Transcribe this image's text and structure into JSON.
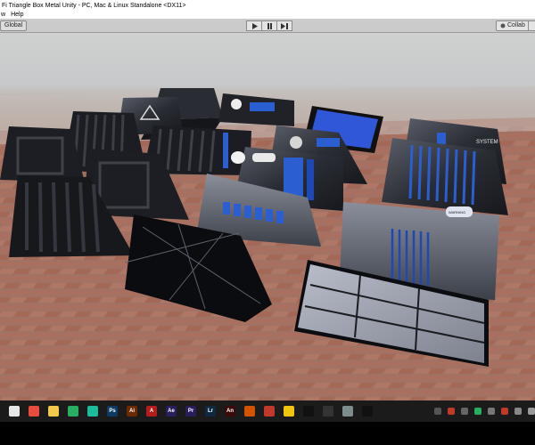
{
  "window": {
    "title": "Fi Triangle Box Metal Unity - PC, Mac & Linux Standalone <DX11>"
  },
  "menu": {
    "items": [
      {
        "label": "w"
      },
      {
        "label": "Help"
      }
    ]
  },
  "toolbar": {
    "global_label": "Global",
    "collab_label": "Collab"
  },
  "scene": {
    "panel_labels": [
      "SYSTEM",
      "WARNING",
      "WARNING"
    ]
  },
  "taskbar": {
    "icons": [
      {
        "name": "windows-start-icon",
        "color": "#e6e6e6",
        "label": ""
      },
      {
        "name": "chrome-icon",
        "color": "#e74c3c",
        "label": ""
      },
      {
        "name": "file-explorer-icon",
        "color": "#f2c94c",
        "label": ""
      },
      {
        "name": "app-icon",
        "color": "#27ae60",
        "label": ""
      },
      {
        "name": "app-icon",
        "color": "#1abc9c",
        "label": ""
      },
      {
        "name": "photoshop-icon",
        "color": "#0d3b66",
        "label": "Ps"
      },
      {
        "name": "illustrator-icon",
        "color": "#6b2a00",
        "label": "Ai"
      },
      {
        "name": "acrobat-icon",
        "color": "#b71c1c",
        "label": "A"
      },
      {
        "name": "after-effects-icon",
        "color": "#2a1d5c",
        "label": "Ae"
      },
      {
        "name": "premiere-icon",
        "color": "#2a1d5c",
        "label": "Pr"
      },
      {
        "name": "lightroom-icon",
        "color": "#0f2942",
        "label": "Lr"
      },
      {
        "name": "animate-icon",
        "color": "#3b0b0b",
        "label": "An"
      },
      {
        "name": "office-icon",
        "color": "#d35400",
        "label": ""
      },
      {
        "name": "app-icon",
        "color": "#c0392b",
        "label": ""
      },
      {
        "name": "app-icon",
        "color": "#f1c40f",
        "label": ""
      },
      {
        "name": "app-icon",
        "color": "#111111",
        "label": ""
      },
      {
        "name": "unity-icon",
        "color": "#333333",
        "label": ""
      },
      {
        "name": "app-icon",
        "color": "#7f8c8d",
        "label": ""
      },
      {
        "name": "app-icon",
        "color": "#111111",
        "label": ""
      }
    ],
    "tray": [
      {
        "name": "tray-icon",
        "color": "#555555"
      },
      {
        "name": "tray-icon",
        "color": "#c0392b"
      },
      {
        "name": "tray-icon",
        "color": "#666666"
      },
      {
        "name": "tray-icon",
        "color": "#27ae60"
      },
      {
        "name": "tray-icon",
        "color": "#777777"
      },
      {
        "name": "tray-icon",
        "color": "#c0392b"
      },
      {
        "name": "tray-icon",
        "color": "#888888"
      },
      {
        "name": "tray-icon",
        "color": "#999999"
      }
    ]
  }
}
